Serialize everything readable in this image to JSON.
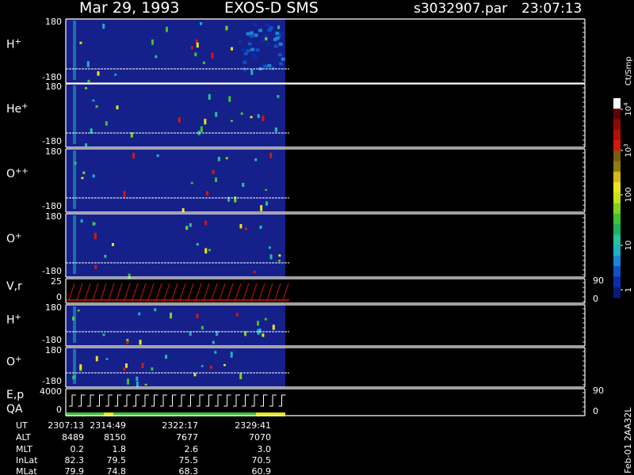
{
  "header": {
    "date": "Mar 29, 1993",
    "instrument": "EXOS-D SMS",
    "file": "s3032907.par",
    "time": "23:07:13"
  },
  "colorbar": {
    "unit_label": "Ct/Smp",
    "ticks": [
      "1",
      "10",
      "100",
      "10",
      "10"
    ],
    "tick_exponents": [
      "",
      "",
      "",
      "3",
      "4"
    ],
    "colors": [
      "#0a1a7a",
      "#0a2fa8",
      "#0f52c8",
      "#1a84d6",
      "#1fb2c4",
      "#22c49a",
      "#1fb25a",
      "#3ec236",
      "#7fd21e",
      "#c6e01a",
      "#e8e51c",
      "#d6b81a",
      "#8c7a14",
      "#7a5a10",
      "#d4180c",
      "#b01008",
      "#8a0a06",
      "#5a0604",
      "#ffffff"
    ]
  },
  "panels": [
    {
      "label": "H",
      "sup": "+",
      "ytop": "180",
      "ybot": "-180"
    },
    {
      "label": "He",
      "sup": "+",
      "ytop": "180",
      "ybot": "-180"
    },
    {
      "label": "O",
      "sup": "++",
      "ytop": "180",
      "ybot": "-180"
    },
    {
      "label": "O",
      "sup": "+",
      "ytop": "180",
      "ybot": "-180"
    },
    {
      "label": "V,r",
      "sup": "",
      "ytop": "25",
      "ybot": "0",
      "right_top": "90",
      "right_bot": "0"
    },
    {
      "label": "H",
      "sup": "+",
      "ytop": "180",
      "ybot": "-180"
    },
    {
      "label": "O",
      "sup": "+",
      "ytop": "180",
      "ybot": "-180"
    },
    {
      "label": "E,p",
      "label2": "QA",
      "sup": "",
      "ytop": "4000",
      "ybot": "0",
      "right_top": "90",
      "right_bot": "0"
    }
  ],
  "ephemeris": {
    "labels": [
      "UT",
      "ALT",
      "MLT",
      "InLat",
      "MLat"
    ],
    "columns": [
      [
        "2307:13",
        "8489",
        "0.2",
        "82.3",
        "79.9"
      ],
      [
        "2314:49",
        "8150",
        "1.8",
        "79.5",
        "74.8"
      ],
      [
        "2322:17",
        "7677",
        "2.6",
        "75.5",
        "68.3"
      ],
      [
        "2329:41",
        "7070",
        "3.0",
        "70.5",
        "60.9"
      ]
    ]
  },
  "footer_vertical": "Feb-01 2AA32L"
}
